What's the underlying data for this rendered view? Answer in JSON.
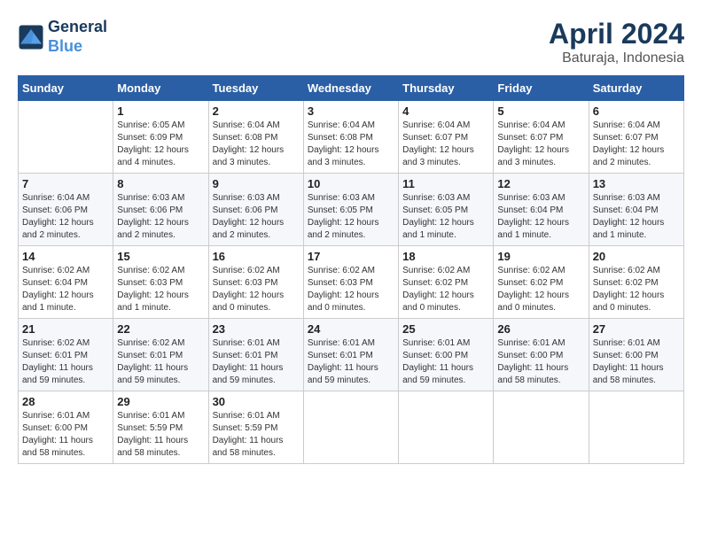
{
  "header": {
    "logo_line1": "General",
    "logo_line2": "Blue",
    "month_title": "April 2024",
    "subtitle": "Baturaja, Indonesia"
  },
  "calendar": {
    "days_of_week": [
      "Sunday",
      "Monday",
      "Tuesday",
      "Wednesday",
      "Thursday",
      "Friday",
      "Saturday"
    ],
    "weeks": [
      [
        {
          "date": "",
          "detail": ""
        },
        {
          "date": "1",
          "detail": "Sunrise: 6:05 AM\nSunset: 6:09 PM\nDaylight: 12 hours\nand 4 minutes."
        },
        {
          "date": "2",
          "detail": "Sunrise: 6:04 AM\nSunset: 6:08 PM\nDaylight: 12 hours\nand 3 minutes."
        },
        {
          "date": "3",
          "detail": "Sunrise: 6:04 AM\nSunset: 6:08 PM\nDaylight: 12 hours\nand 3 minutes."
        },
        {
          "date": "4",
          "detail": "Sunrise: 6:04 AM\nSunset: 6:07 PM\nDaylight: 12 hours\nand 3 minutes."
        },
        {
          "date": "5",
          "detail": "Sunrise: 6:04 AM\nSunset: 6:07 PM\nDaylight: 12 hours\nand 3 minutes."
        },
        {
          "date": "6",
          "detail": "Sunrise: 6:04 AM\nSunset: 6:07 PM\nDaylight: 12 hours\nand 2 minutes."
        }
      ],
      [
        {
          "date": "7",
          "detail": "Sunrise: 6:04 AM\nSunset: 6:06 PM\nDaylight: 12 hours\nand 2 minutes."
        },
        {
          "date": "8",
          "detail": "Sunrise: 6:03 AM\nSunset: 6:06 PM\nDaylight: 12 hours\nand 2 minutes."
        },
        {
          "date": "9",
          "detail": "Sunrise: 6:03 AM\nSunset: 6:06 PM\nDaylight: 12 hours\nand 2 minutes."
        },
        {
          "date": "10",
          "detail": "Sunrise: 6:03 AM\nSunset: 6:05 PM\nDaylight: 12 hours\nand 2 minutes."
        },
        {
          "date": "11",
          "detail": "Sunrise: 6:03 AM\nSunset: 6:05 PM\nDaylight: 12 hours\nand 1 minute."
        },
        {
          "date": "12",
          "detail": "Sunrise: 6:03 AM\nSunset: 6:04 PM\nDaylight: 12 hours\nand 1 minute."
        },
        {
          "date": "13",
          "detail": "Sunrise: 6:03 AM\nSunset: 6:04 PM\nDaylight: 12 hours\nand 1 minute."
        }
      ],
      [
        {
          "date": "14",
          "detail": "Sunrise: 6:02 AM\nSunset: 6:04 PM\nDaylight: 12 hours\nand 1 minute."
        },
        {
          "date": "15",
          "detail": "Sunrise: 6:02 AM\nSunset: 6:03 PM\nDaylight: 12 hours\nand 1 minute."
        },
        {
          "date": "16",
          "detail": "Sunrise: 6:02 AM\nSunset: 6:03 PM\nDaylight: 12 hours\nand 0 minutes."
        },
        {
          "date": "17",
          "detail": "Sunrise: 6:02 AM\nSunset: 6:03 PM\nDaylight: 12 hours\nand 0 minutes."
        },
        {
          "date": "18",
          "detail": "Sunrise: 6:02 AM\nSunset: 6:02 PM\nDaylight: 12 hours\nand 0 minutes."
        },
        {
          "date": "19",
          "detail": "Sunrise: 6:02 AM\nSunset: 6:02 PM\nDaylight: 12 hours\nand 0 minutes."
        },
        {
          "date": "20",
          "detail": "Sunrise: 6:02 AM\nSunset: 6:02 PM\nDaylight: 12 hours\nand 0 minutes."
        }
      ],
      [
        {
          "date": "21",
          "detail": "Sunrise: 6:02 AM\nSunset: 6:01 PM\nDaylight: 11 hours\nand 59 minutes."
        },
        {
          "date": "22",
          "detail": "Sunrise: 6:02 AM\nSunset: 6:01 PM\nDaylight: 11 hours\nand 59 minutes."
        },
        {
          "date": "23",
          "detail": "Sunrise: 6:01 AM\nSunset: 6:01 PM\nDaylight: 11 hours\nand 59 minutes."
        },
        {
          "date": "24",
          "detail": "Sunrise: 6:01 AM\nSunset: 6:01 PM\nDaylight: 11 hours\nand 59 minutes."
        },
        {
          "date": "25",
          "detail": "Sunrise: 6:01 AM\nSunset: 6:00 PM\nDaylight: 11 hours\nand 59 minutes."
        },
        {
          "date": "26",
          "detail": "Sunrise: 6:01 AM\nSunset: 6:00 PM\nDaylight: 11 hours\nand 58 minutes."
        },
        {
          "date": "27",
          "detail": "Sunrise: 6:01 AM\nSunset: 6:00 PM\nDaylight: 11 hours\nand 58 minutes."
        }
      ],
      [
        {
          "date": "28",
          "detail": "Sunrise: 6:01 AM\nSunset: 6:00 PM\nDaylight: 11 hours\nand 58 minutes."
        },
        {
          "date": "29",
          "detail": "Sunrise: 6:01 AM\nSunset: 5:59 PM\nDaylight: 11 hours\nand 58 minutes."
        },
        {
          "date": "30",
          "detail": "Sunrise: 6:01 AM\nSunset: 5:59 PM\nDaylight: 11 hours\nand 58 minutes."
        },
        {
          "date": "",
          "detail": ""
        },
        {
          "date": "",
          "detail": ""
        },
        {
          "date": "",
          "detail": ""
        },
        {
          "date": "",
          "detail": ""
        }
      ]
    ]
  }
}
